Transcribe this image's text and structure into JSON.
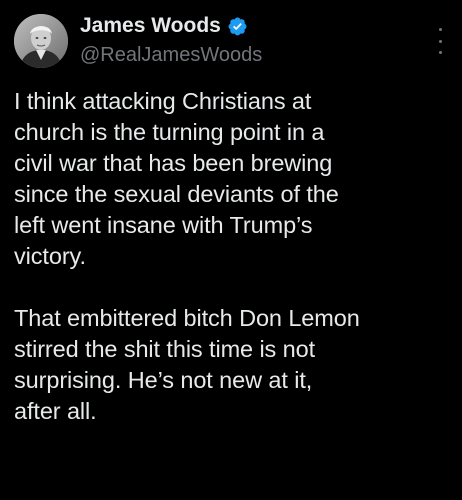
{
  "author": {
    "display_name": "James Woods",
    "handle": "@RealJamesWoods",
    "verified": true,
    "verified_color": "#1d9bf0"
  },
  "icons": {
    "avatar": "profile-photo",
    "verified": "verified-check-badge",
    "more": "vertical-ellipsis"
  },
  "tweet": {
    "paragraphs": [
      {
        "lines": [
          "I think attacking Christians at",
          "church is the turning point in a",
          "civil war that has been brewing",
          "since the sexual deviants of the",
          "left went insane with Trump’s",
          "victory."
        ]
      },
      {
        "lines": [
          "That embittered bitch Don Lemon",
          "stirred the shit this time is not",
          "surprising. He’s not new at it,",
          "after all."
        ]
      }
    ]
  },
  "colors": {
    "background": "#000000",
    "text_primary": "#e7e9ea",
    "text_secondary": "#71767b"
  }
}
